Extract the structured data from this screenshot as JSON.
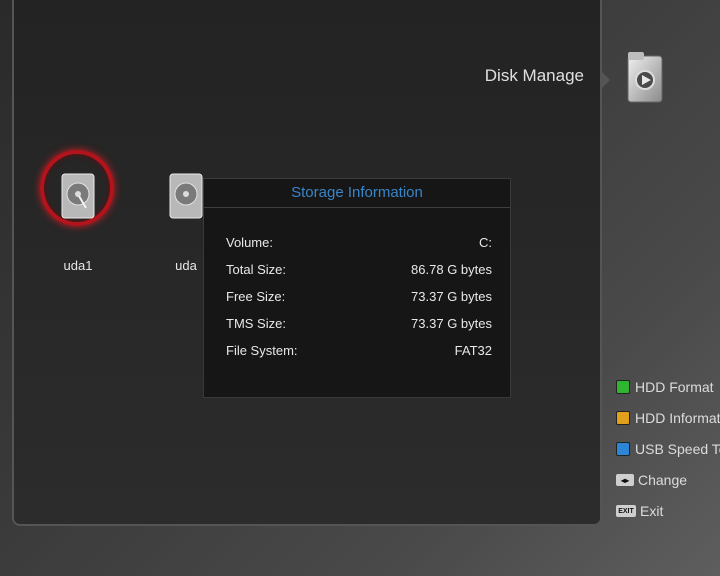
{
  "header": {
    "title": "Disk Manage",
    "icon": "folder-play-icon"
  },
  "disks": [
    {
      "label": "uda1",
      "icon": "hdd-icon",
      "selected": true
    },
    {
      "label": "uda",
      "icon": "hdd-icon",
      "selected": false
    }
  ],
  "storage_info": {
    "title": "Storage Information",
    "rows": [
      {
        "label": "Volume:",
        "value": "C:"
      },
      {
        "label": "Total Size:",
        "value": "86.78 G bytes"
      },
      {
        "label": "Free Size:",
        "value": "73.37 G bytes"
      },
      {
        "label": "TMS Size:",
        "value": "73.37 G bytes"
      },
      {
        "label": "File System:",
        "value": "FAT32"
      }
    ]
  },
  "legend": [
    {
      "label": "HDD Format",
      "color": "#2fb52f"
    },
    {
      "label": "HDD Informatio",
      "color": "#e0a01c"
    },
    {
      "label": "USB Speed Tes",
      "color": "#2c86d6"
    },
    {
      "label": "Change",
      "key": "◂▸"
    },
    {
      "label": "Exit",
      "key": "EXIT"
    }
  ],
  "colors": {
    "accent": "#3a84c8",
    "selection_ring": "#b3141c"
  }
}
